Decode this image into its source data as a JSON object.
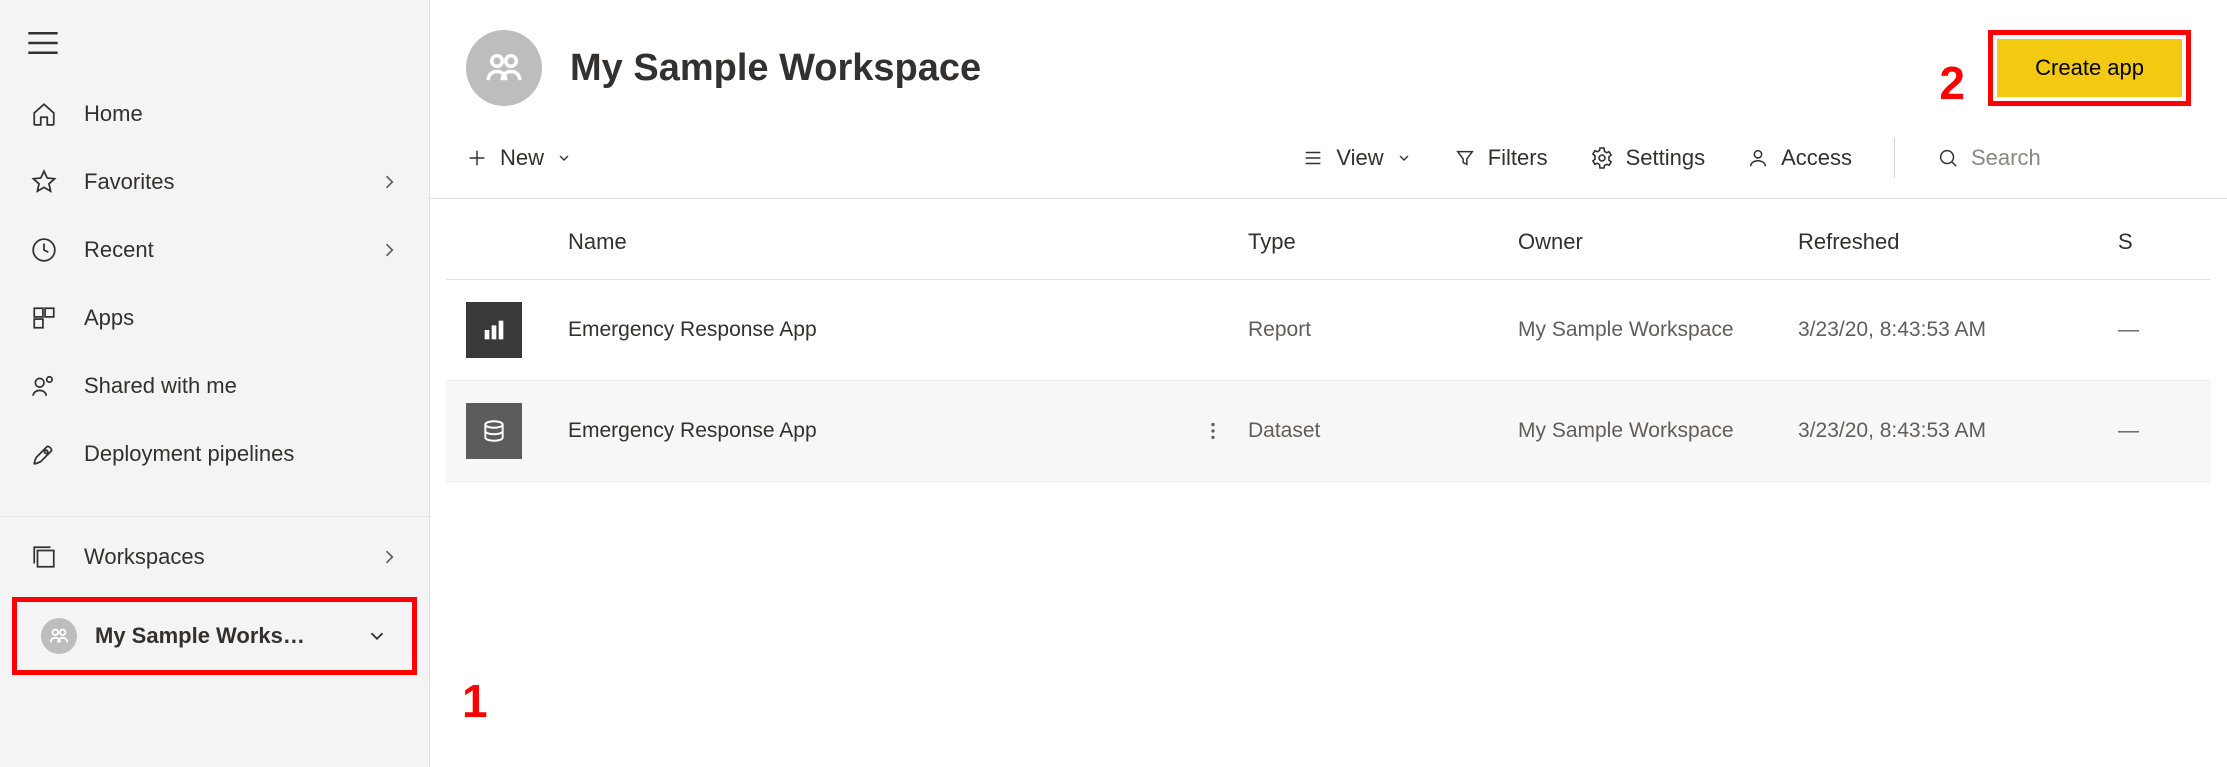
{
  "annotations": {
    "one": "1",
    "two": "2"
  },
  "sidebar": {
    "items": [
      {
        "label": "Home"
      },
      {
        "label": "Favorites"
      },
      {
        "label": "Recent"
      },
      {
        "label": "Apps"
      },
      {
        "label": "Shared with me"
      },
      {
        "label": "Deployment pipelines"
      },
      {
        "label": "Workspaces"
      }
    ],
    "current_workspace_label": "My Sample Works…"
  },
  "workspace": {
    "title": "My Sample Workspace",
    "create_app_label": "Create app"
  },
  "toolbar": {
    "new_label": "New",
    "view_label": "View",
    "filters_label": "Filters",
    "settings_label": "Settings",
    "access_label": "Access",
    "search_placeholder": "Search"
  },
  "table": {
    "headers": {
      "name": "Name",
      "type": "Type",
      "owner": "Owner",
      "refreshed": "Refreshed",
      "sensitivity": "S"
    },
    "rows": [
      {
        "icon": "report",
        "name": "Emergency Response App",
        "type": "Report",
        "owner": "My Sample Workspace",
        "refreshed": "3/23/20, 8:43:53 AM",
        "sensitivity": "—"
      },
      {
        "icon": "dataset",
        "name": "Emergency Response App",
        "type": "Dataset",
        "owner": "My Sample Workspace",
        "refreshed": "3/23/20, 8:43:53 AM",
        "sensitivity": "—"
      }
    ]
  }
}
